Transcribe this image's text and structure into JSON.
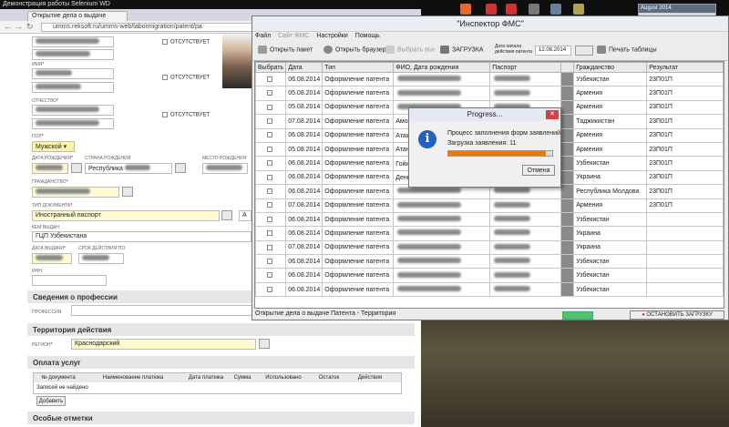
{
  "window_title": "Демонстрация работы Selenium WD",
  "browser": {
    "tab": "Открытие дела о выдаче",
    "url": "umms.reksoft.ru/umms-web/labormigration/patent/pa"
  },
  "taskbar": {
    "calendar_title": "August 2014"
  },
  "form": {
    "absent_label": "ОТСУТСТВУЕТ",
    "name_label": "ИМЯ",
    "patronymic_label": "ОТЧЕСТВО",
    "sex_label": "ПОЛ",
    "sex_value": "Мужской",
    "dob_label": "ДАТА РОЖДЕНИЯ",
    "country_label": "СТРАНА РОЖДЕНИЯ",
    "country_value": "Республика",
    "place_label": "МЕСТО РОЖДЕНИЯ",
    "citizenship_label": "ГРАЖДАНСТВО",
    "doctype_label": "ТИП ДОКУМЕНТА",
    "doctype_value": "Иностранный паспорт",
    "issuer_label": "КЕМ ВЫДАН",
    "issuer_value": "ГЦП Узбекистана",
    "issued_label": "ДАТА ВЫДАЧИ",
    "validity_label": "СРОК ДЕЙСТВИЯ ПО",
    "inn_label": "ИНН",
    "prof_section": "Сведения о профессии",
    "prof_label": "ПРОФЕССИЯ",
    "territory_section": "Территория действия",
    "region_label": "РЕГИОН",
    "region_value": "Краснодарский",
    "payment_section": "Оплата услуг",
    "payment_headers": [
      "№ документа",
      "Наименование платежа",
      "Дата платежа",
      "Сумма",
      "Использовано",
      "Остаток",
      "Действия"
    ],
    "no_records": "Записей не найдено",
    "add_button": "Добавить",
    "special_section": "Особые отметки"
  },
  "fms": {
    "title": "\"Инспектор ФМС\"",
    "menu": [
      "Файл",
      "Сайт ФМС",
      "Настройки",
      "Помощь"
    ],
    "toolbar": {
      "open_packet": "Открыть пакет",
      "open_browser": "Открыть браузер",
      "select_all": "Выбрать все",
      "load": "ЗАГРУЗКА",
      "date_label": "Дата начала действия патента",
      "date_value": "12.08.2014",
      "print": "Печать таблицы"
    },
    "headers": [
      "Выбрать",
      "Дата",
      "Тип",
      "ФИО, Дата рождения",
      "Паспорт",
      "",
      "Гражданство",
      "Результат"
    ],
    "rows": [
      {
        "date": "06.08.2014",
        "type": "Оформление патента",
        "fio": "",
        "passport": "",
        "citizenship": "Узбекистан",
        "result": "23П01П"
      },
      {
        "date": "05.08.2014",
        "type": "Оформление патента",
        "fio": "",
        "passport": "",
        "citizenship": "Армения",
        "result": "23П01П"
      },
      {
        "date": "05.08.2014",
        "type": "Оформление патента",
        "fio": "",
        "passport": "",
        "citizenship": "Армения",
        "result": "23П01П"
      },
      {
        "date": "07.08.2014",
        "type": "Оформление патента",
        "fio": "Амоно",
        "passport": "",
        "citizenship": "Таджикистан",
        "result": "23П01П"
      },
      {
        "date": "06.08.2014",
        "type": "Оформление патента",
        "fio": "Атажа",
        "passport": "",
        "citizenship": "Армения",
        "result": "23П01П"
      },
      {
        "date": "05.08.2014",
        "type": "Оформление патента",
        "fio": "Атане",
        "passport": "",
        "citizenship": "Армения",
        "result": "23П01П"
      },
      {
        "date": "06.08.2014",
        "type": "Оформление патента",
        "fio": "Гойин",
        "passport": "",
        "citizenship": "Узбекистан",
        "result": "23П01П"
      },
      {
        "date": "06.08.2014",
        "type": "Оформление патента",
        "fio": "Денни",
        "passport": "",
        "citizenship": "Украина",
        "result": "23П01П"
      },
      {
        "date": "06.08.2014",
        "type": "Оформление патента",
        "fio": "",
        "passport": "",
        "citizenship": "Республика Молдова",
        "result": "23П01П"
      },
      {
        "date": "07.08.2014",
        "type": "Оформление патента",
        "fio": "",
        "passport": "",
        "citizenship": "Армения",
        "result": "23П01П"
      },
      {
        "date": "06.08.2014",
        "type": "Оформление патента",
        "fio": "",
        "passport": "",
        "citizenship": "Узбекистан",
        "result": ""
      },
      {
        "date": "06.08.2014",
        "type": "Оформление патента",
        "fio": "",
        "passport": "",
        "citizenship": "Украина",
        "result": ""
      },
      {
        "date": "07.08.2014",
        "type": "Оформление патента",
        "fio": "",
        "passport": "",
        "citizenship": "Украина",
        "result": ""
      },
      {
        "date": "06.08.2014",
        "type": "Оформление патента",
        "fio": "",
        "passport": "",
        "citizenship": "Узбекистан",
        "result": ""
      },
      {
        "date": "06.08.2014",
        "type": "Оформление патента",
        "fio": "",
        "passport": "",
        "citizenship": "Узбекистан",
        "result": ""
      },
      {
        "date": "06.08.2014",
        "type": "Оформление патента",
        "fio": "",
        "passport": "",
        "citizenship": "Узбекистан",
        "result": ""
      }
    ],
    "status": "Открытие дела о выдаче Патента - Территория",
    "stop_button": "ОСТАНОВИТЬ ЗАГРУЗКУ"
  },
  "progress": {
    "title": "Progress...",
    "line1": "Процесс заполнения форм заявлений ...",
    "line2": "Загрузка заявления: 11",
    "fraction": 0.94,
    "cancel": "Отмена"
  }
}
